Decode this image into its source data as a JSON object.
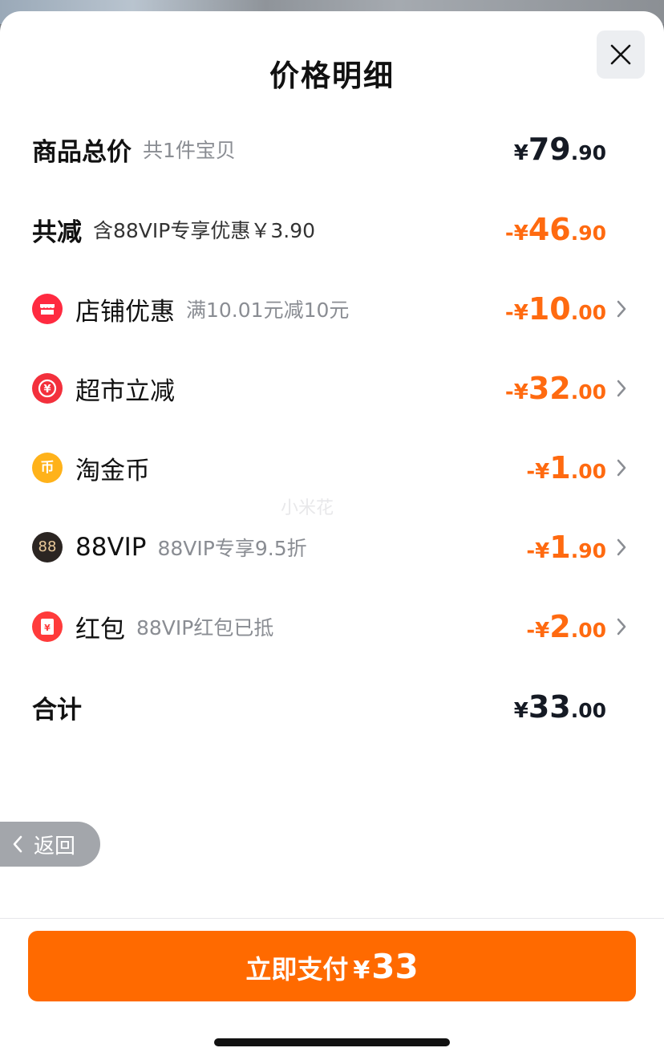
{
  "sheet": {
    "title": "价格明细"
  },
  "rows": {
    "goods": {
      "label": "商品总价",
      "sub": "共1件宝贝",
      "sym": "¥",
      "int": "79",
      "dec": ".90"
    },
    "discount_total": {
      "label": "共减",
      "sub": "含88VIP专享优惠￥3.90",
      "sym": "-¥",
      "int": "46",
      "dec": ".90"
    },
    "store": {
      "label": "店铺优惠",
      "sub": "满10.01元减10元",
      "sym": "-¥",
      "int": "10",
      "dec": ".00",
      "icon": "store-icon"
    },
    "market": {
      "label": "超市立减",
      "sym": "-¥",
      "int": "32",
      "dec": ".00",
      "icon": "yen-circle-icon"
    },
    "coin": {
      "label": "淘金币",
      "sym": "-¥",
      "int": "1",
      "dec": ".00",
      "icon": "coin-icon",
      "glyph": "币"
    },
    "vip": {
      "label": "88VIP",
      "sub": "88VIP专享9.5折",
      "sym": "-¥",
      "int": "1",
      "dec": ".90",
      "icon": "vip-88-icon",
      "glyph": "88"
    },
    "redpack": {
      "label": "红包",
      "sub": "88VIP红包已抵",
      "sym": "-¥",
      "int": "2",
      "dec": ".00",
      "icon": "red-packet-icon",
      "glyph": "¥"
    },
    "total": {
      "label": "合计",
      "sym": "¥",
      "int": "33",
      "dec": ".00"
    }
  },
  "watermark": "小米花",
  "back": {
    "label": "返回"
  },
  "pay": {
    "label": "立即支付",
    "sym": "¥",
    "amount": "33"
  },
  "colors": {
    "accent": "#ff6a00",
    "discount_text": "#ff6a10",
    "amount_dark": "#151a24",
    "sub_text": "#8a8d93"
  }
}
